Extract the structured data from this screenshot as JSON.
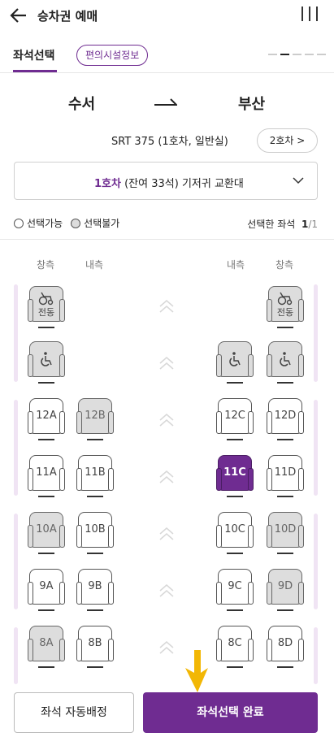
{
  "header": {
    "title": "승차권 예매",
    "back_icon": "arrow-left-icon",
    "menu_icon": "menu-icon"
  },
  "tabs": {
    "seat_select": "좌석선택",
    "facility_info": "편의시설정보"
  },
  "route": {
    "from": "수서",
    "to": "부산"
  },
  "train": {
    "info": "SRT 375 (1호차, 일반실)",
    "next_car": "2호차 >"
  },
  "car_select": {
    "car": "1호차",
    "detail": "(잔여 33석) 기저귀 교환대"
  },
  "legend": {
    "available": "선택가능",
    "unavailable": "선택불가"
  },
  "selected": {
    "label": "선택한 좌석",
    "count": "1",
    "total": "/1"
  },
  "columns": {
    "window_left": "창측",
    "aisle_left": "내측",
    "aisle_right": "내측",
    "window_right": "창측"
  },
  "seats": {
    "wheel_l": "전동",
    "wheel_r": "전동",
    "12A": "12A",
    "12B": "12B",
    "12C": "12C",
    "12D": "12D",
    "11A": "11A",
    "11B": "11B",
    "11C": "11C",
    "11D": "11D",
    "10A": "10A",
    "10B": "10B",
    "10C": "10C",
    "10D": "10D",
    "9A": "9A",
    "9B": "9B",
    "9C": "9C",
    "9D": "9D",
    "8A": "8A",
    "8B": "8B",
    "8C": "8C",
    "8D": "8D"
  },
  "buttons": {
    "auto_assign": "좌석 자동배정",
    "complete": "좌석선택 완료"
  },
  "colors": {
    "accent": "#6f2c91",
    "unavailable": "#dddddd",
    "pointer": "#f2b705"
  }
}
